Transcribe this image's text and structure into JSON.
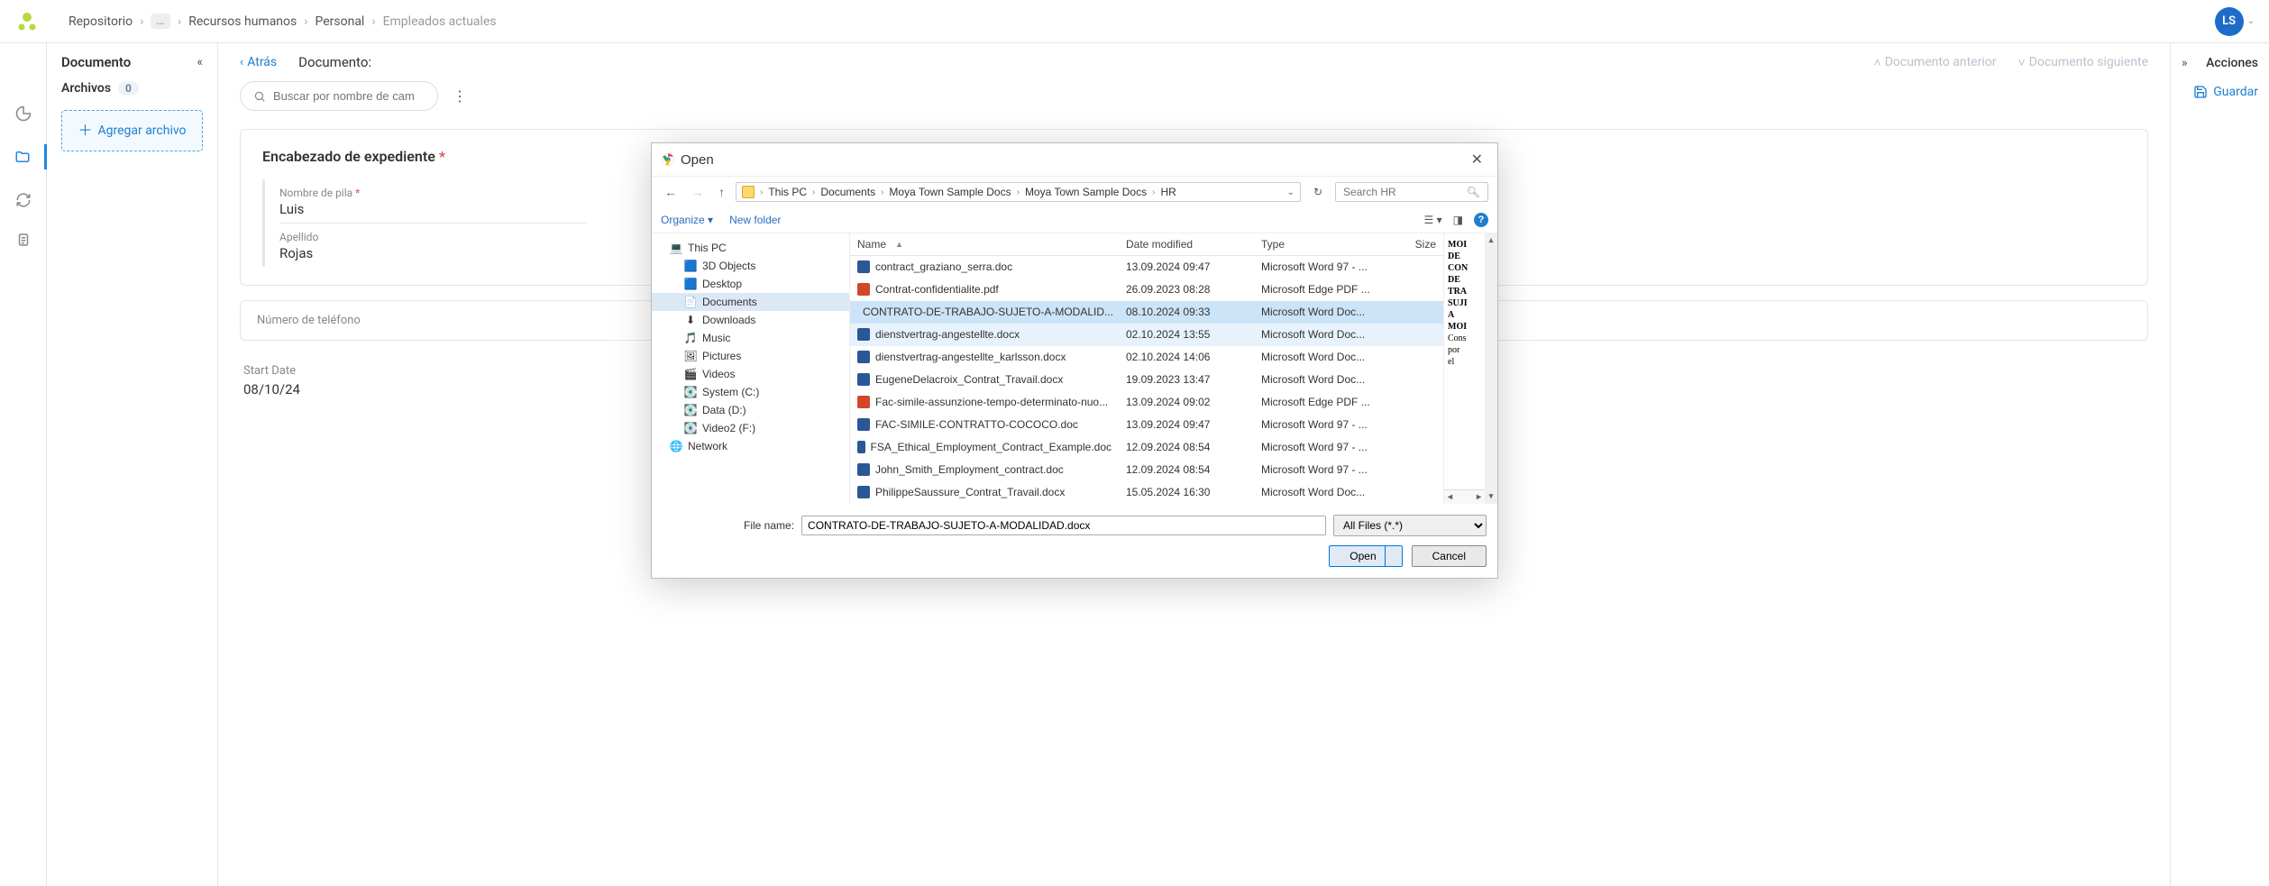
{
  "topbar": {
    "breadcrumb": [
      "Repositorio",
      "…",
      "Recursos humanos",
      "Personal",
      "Empleados actuales"
    ],
    "avatar_initials": "LS"
  },
  "panel1": {
    "title": "Documento",
    "archivos_label": "Archivos",
    "archivos_count": "0",
    "add_file_label": "Agregar archivo"
  },
  "content": {
    "back_label": "Atrás",
    "doc_label": "Documento:",
    "prev_doc": "Documento anterior",
    "next_doc": "Documento siguiente",
    "search_placeholder": "Buscar por nombre de cam",
    "header_card_title": "Encabezado de expediente",
    "fields": {
      "first_name_label": "Nombre de pila",
      "first_name_value": "Luis",
      "last_name_label": "Apellido",
      "last_name_value": "Rojas"
    },
    "phone_label": "Número de teléfono",
    "start_date_label": "Start Date",
    "start_date_value": "08/10/24"
  },
  "panel_right": {
    "title": "Acciones",
    "save_label": "Guardar"
  },
  "dialog": {
    "title": "Open",
    "path": [
      "This PC",
      "Documents",
      "Moya Town Sample Docs",
      "Moya Town Sample Docs",
      "HR"
    ],
    "search_placeholder": "Search HR",
    "toolbar": {
      "organize": "Organize",
      "new_folder": "New folder"
    },
    "tree": [
      {
        "label": "This PC",
        "icon": "pc",
        "indent": 0
      },
      {
        "label": "3D Objects",
        "icon": "folder",
        "indent": 1
      },
      {
        "label": "Desktop",
        "icon": "desktop",
        "indent": 1
      },
      {
        "label": "Documents",
        "icon": "docs",
        "indent": 1,
        "selected": true
      },
      {
        "label": "Downloads",
        "icon": "down",
        "indent": 1
      },
      {
        "label": "Music",
        "icon": "music",
        "indent": 1
      },
      {
        "label": "Pictures",
        "icon": "pic",
        "indent": 1
      },
      {
        "label": "Videos",
        "icon": "vid",
        "indent": 1
      },
      {
        "label": "System (C:)",
        "icon": "drive",
        "indent": 1
      },
      {
        "label": "Data (D:)",
        "icon": "drive",
        "indent": 1
      },
      {
        "label": "Video2 (F:)",
        "icon": "drive",
        "indent": 1
      },
      {
        "label": "Network",
        "icon": "net",
        "indent": 0
      }
    ],
    "columns": {
      "name": "Name",
      "date": "Date modified",
      "type": "Type",
      "size": "Size"
    },
    "files": [
      {
        "name": "contract_graziano_serra.doc",
        "date": "13.09.2024 09:47",
        "type": "Microsoft Word 97 - ...",
        "icon": "doc"
      },
      {
        "name": "Contrat-confidentialite.pdf",
        "date": "26.09.2023 08:28",
        "type": "Microsoft Edge PDF ...",
        "icon": "pdf"
      },
      {
        "name": "CONTRATO-DE-TRABAJO-SUJETO-A-MODALID...",
        "date": "08.10.2024 09:33",
        "type": "Microsoft Word Doc...",
        "icon": "docx",
        "selected": true
      },
      {
        "name": "dienstvertrag-angestellte.docx",
        "date": "02.10.2024 13:55",
        "type": "Microsoft Word Doc...",
        "icon": "docx",
        "hover": true
      },
      {
        "name": "dienstvertrag-angestellte_karlsson.docx",
        "date": "02.10.2024 14:06",
        "type": "Microsoft Word Doc...",
        "icon": "docx"
      },
      {
        "name": "EugeneDelacroix_Contrat_Travail.docx",
        "date": "19.09.2023 13:47",
        "type": "Microsoft Word Doc...",
        "icon": "docx"
      },
      {
        "name": "Fac-simile-assunzione-tempo-determinato-nuo...",
        "date": "13.09.2024 09:02",
        "type": "Microsoft Edge PDF ...",
        "icon": "pdf"
      },
      {
        "name": "FAC-SIMILE-CONTRATTO-COCOCO.doc",
        "date": "13.09.2024 09:47",
        "type": "Microsoft Word 97 - ...",
        "icon": "doc"
      },
      {
        "name": "FSA_Ethical_Employment_Contract_Example.doc",
        "date": "12.09.2024 08:54",
        "type": "Microsoft Word 97 - ...",
        "icon": "doc"
      },
      {
        "name": "John_Smith_Employment_contract.doc",
        "date": "12.09.2024 08:54",
        "type": "Microsoft Word 97 - ...",
        "icon": "doc"
      },
      {
        "name": "PhilippeSaussure_Contrat_Travail.docx",
        "date": "15.05.2024 16:30",
        "type": "Microsoft Word Doc...",
        "icon": "docx"
      }
    ],
    "preview_lines": [
      "MOI",
      "DE",
      "CON",
      "DE",
      "TRA",
      "SUJI",
      "A",
      "MOI",
      "",
      "Cons",
      "por",
      "el"
    ],
    "filename_label": "File name:",
    "filename_value": "CONTRATO-DE-TRABAJO-SUJETO-A-MODALIDAD.docx",
    "filetype": "All Files (*.*)",
    "open_btn": "Open",
    "cancel_btn": "Cancel"
  }
}
